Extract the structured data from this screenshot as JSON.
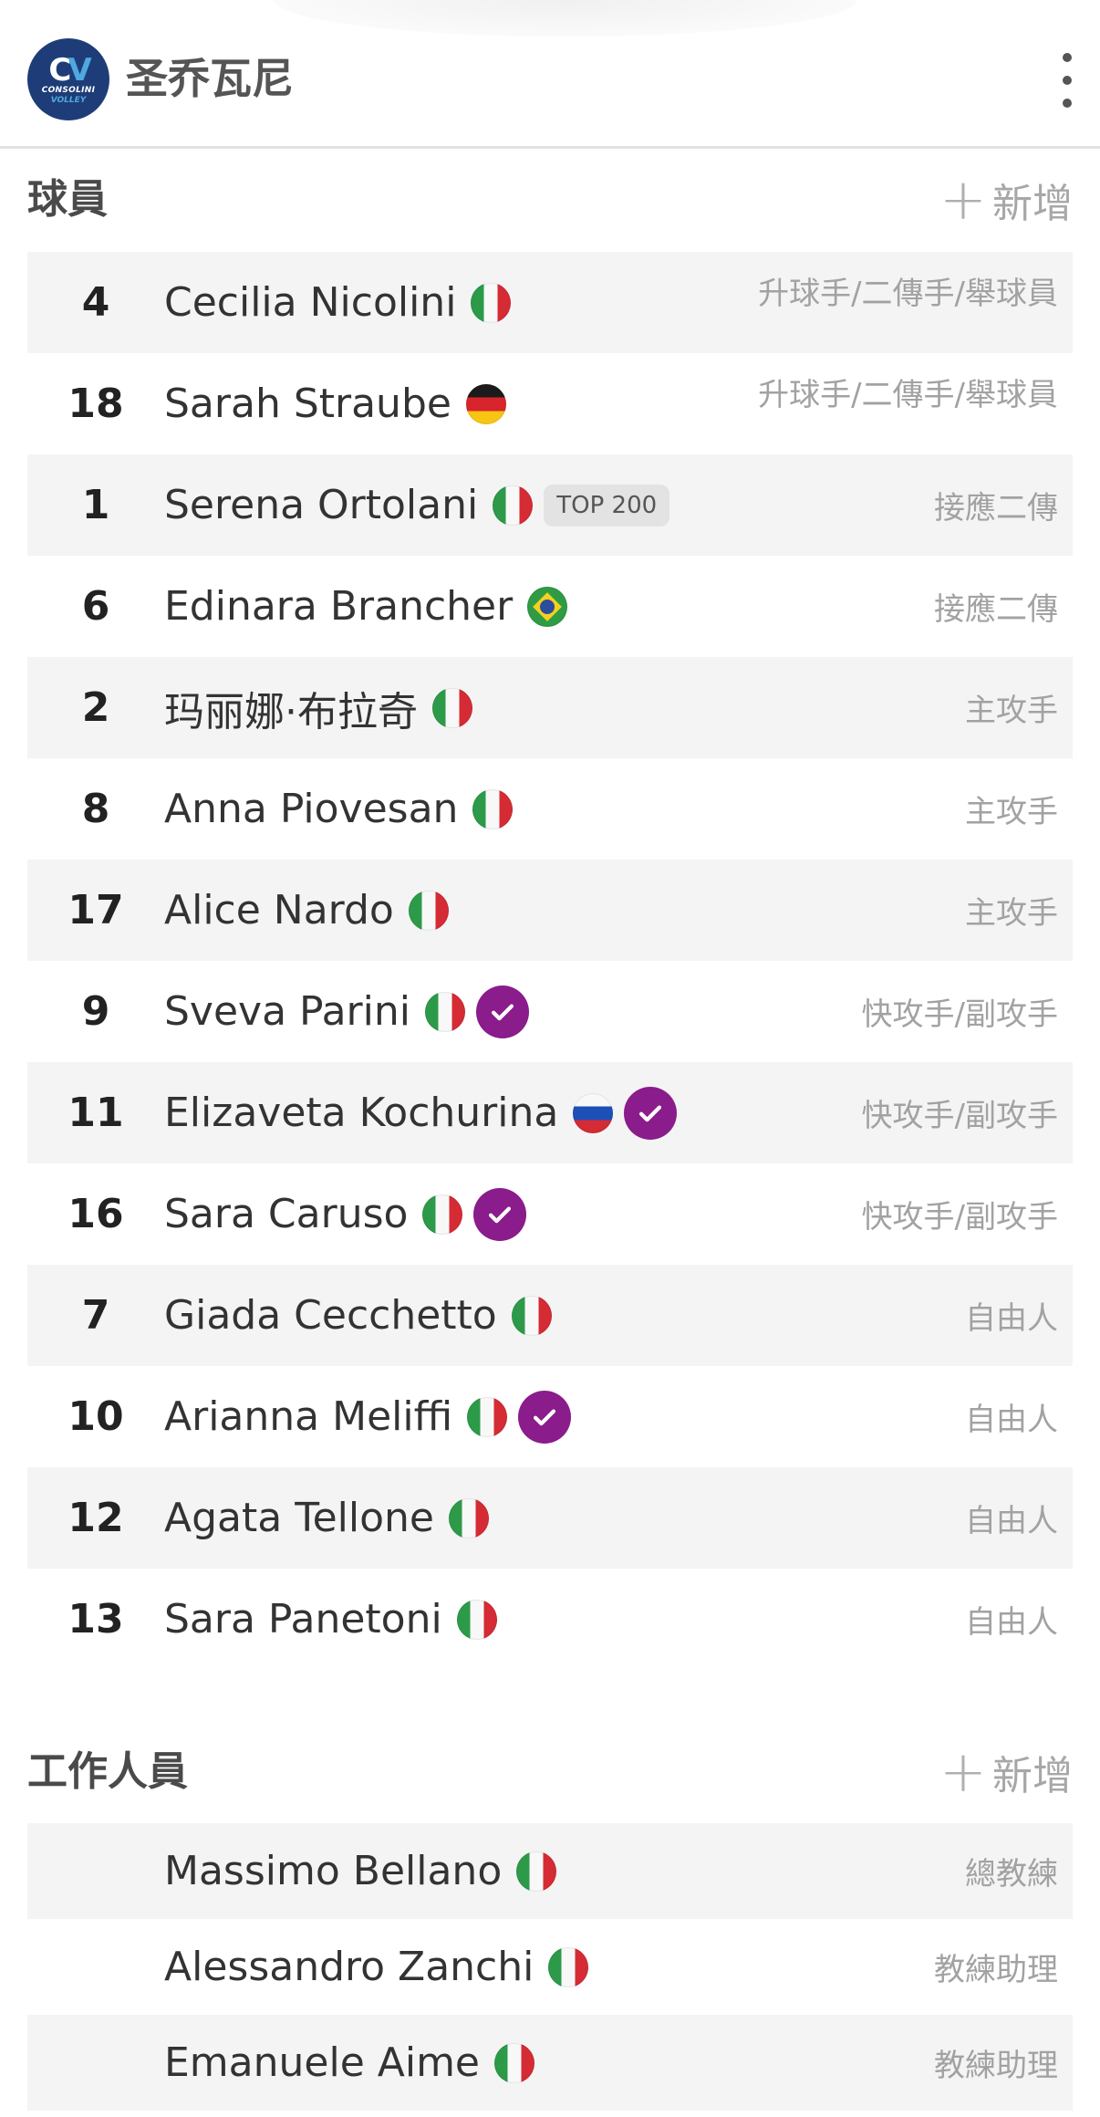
{
  "header": {
    "logo_text_1": "CONSOLINI",
    "logo_text_2": "VOLLEY",
    "title": "圣乔瓦尼",
    "menu_icon": "more-vertical-icon"
  },
  "players_section": {
    "title": "球員",
    "add_label": "新增",
    "add_icon": "plus-icon"
  },
  "players": [
    {
      "number": "4",
      "name": "Cecilia Nicolini",
      "flag": "it",
      "role": "升球手/二傳手/舉球員",
      "verified": false,
      "tag": ""
    },
    {
      "number": "18",
      "name": "Sarah Straube",
      "flag": "de",
      "role": "升球手/二傳手/舉球員",
      "verified": false,
      "tag": ""
    },
    {
      "number": "1",
      "name": "Serena Ortolani",
      "flag": "it",
      "role": "接應二傳",
      "verified": false,
      "tag": "TOP 200"
    },
    {
      "number": "6",
      "name": "Edinara Brancher",
      "flag": "br",
      "role": "接應二傳",
      "verified": false,
      "tag": ""
    },
    {
      "number": "2",
      "name": "玛丽娜·布拉奇",
      "flag": "it",
      "role": "主攻手",
      "verified": false,
      "tag": ""
    },
    {
      "number": "8",
      "name": "Anna Piovesan",
      "flag": "it",
      "role": "主攻手",
      "verified": false,
      "tag": ""
    },
    {
      "number": "17",
      "name": "Alice Nardo",
      "flag": "it",
      "role": "主攻手",
      "verified": false,
      "tag": ""
    },
    {
      "number": "9",
      "name": "Sveva Parini",
      "flag": "it",
      "role": "快攻手/副攻手",
      "verified": true,
      "tag": ""
    },
    {
      "number": "11",
      "name": "Elizaveta Kochurina",
      "flag": "ru",
      "role": "快攻手/副攻手",
      "verified": true,
      "tag": ""
    },
    {
      "number": "16",
      "name": "Sara Caruso",
      "flag": "it",
      "role": "快攻手/副攻手",
      "verified": true,
      "tag": ""
    },
    {
      "number": "7",
      "name": "Giada Cecchetto",
      "flag": "it",
      "role": "自由人",
      "verified": false,
      "tag": ""
    },
    {
      "number": "10",
      "name": "Arianna Meliffi",
      "flag": "it",
      "role": "自由人",
      "verified": true,
      "tag": ""
    },
    {
      "number": "12",
      "name": "Agata Tellone",
      "flag": "it",
      "role": "自由人",
      "verified": false,
      "tag": ""
    },
    {
      "number": "13",
      "name": "Sara Panetoni",
      "flag": "it",
      "role": "自由人",
      "verified": false,
      "tag": ""
    }
  ],
  "staff_section": {
    "title": "工作人員",
    "add_label": "新增",
    "add_icon": "plus-icon"
  },
  "staff": [
    {
      "name": "Massimo Bellano",
      "flag": "it",
      "role": "總教練"
    },
    {
      "name": "Alessandro Zanchi",
      "flag": "it",
      "role": "教練助理"
    },
    {
      "name": "Emanuele Aime",
      "flag": "it",
      "role": "教練助理"
    }
  ],
  "colors": {
    "verified": "#8a1c8c",
    "stripe": "#f4f4f4",
    "logo_bg": "#1e3d78"
  }
}
